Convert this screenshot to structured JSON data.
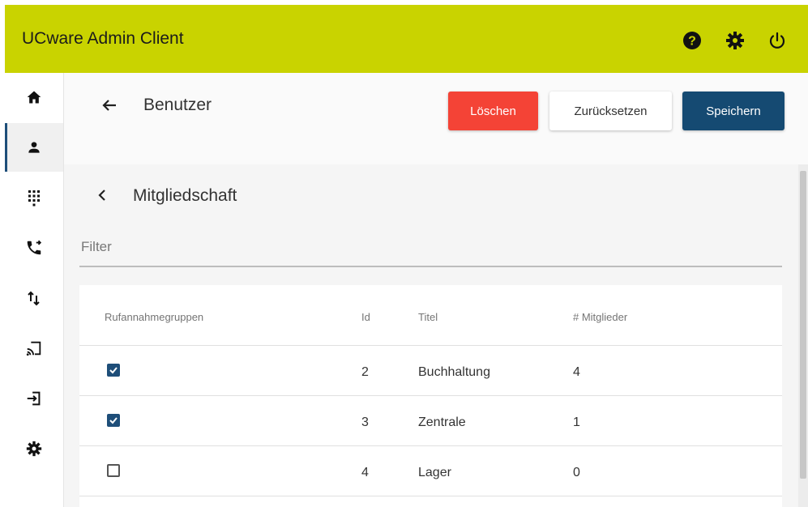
{
  "header": {
    "title": "UCware Admin Client"
  },
  "sidebar": {
    "items": [
      {
        "name": "home",
        "icon": "home-icon"
      },
      {
        "name": "users",
        "icon": "user-icon",
        "active": true
      },
      {
        "name": "dialpad",
        "icon": "dialpad-icon"
      },
      {
        "name": "call-forward",
        "icon": "phone-forward-icon"
      },
      {
        "name": "transfer",
        "icon": "swap-vertical-icon"
      },
      {
        "name": "cast",
        "icon": "cast-icon"
      },
      {
        "name": "login",
        "icon": "login-icon"
      },
      {
        "name": "settings",
        "icon": "gear-icon"
      }
    ]
  },
  "page": {
    "title": "Benutzer",
    "buttons": {
      "delete": "Löschen",
      "reset": "Zurücksetzen",
      "save": "Speichern"
    },
    "section_title": "Mitgliedschaft",
    "filter_placeholder": "Filter"
  },
  "table": {
    "columns": [
      "Rufannahmegruppen",
      "Id",
      "Titel",
      "# Mitglieder"
    ],
    "rows": [
      {
        "checked": true,
        "id": "2",
        "title": "Buchhaltung",
        "members": "4"
      },
      {
        "checked": true,
        "id": "3",
        "title": "Zentrale",
        "members": "1"
      },
      {
        "checked": false,
        "id": "4",
        "title": "Lager",
        "members": "0"
      }
    ]
  },
  "colors": {
    "appbar": "#c9d300",
    "delete": "#f44336",
    "save": "#154a72",
    "accent": "#1e4e79"
  }
}
